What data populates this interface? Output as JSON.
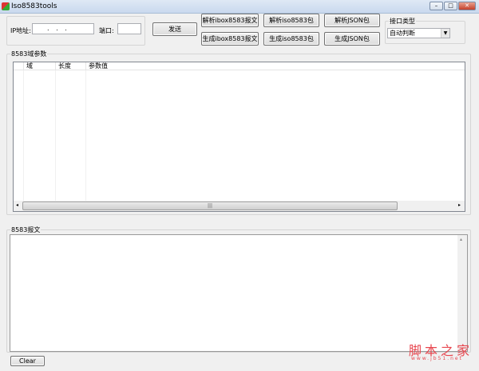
{
  "window": {
    "title": "Iso8583tools",
    "minimize": "–",
    "maximize": "□",
    "close": "✕"
  },
  "connection": {
    "ip_label": "IP地址:",
    "ip_value": ".   .   .",
    "port_label": "端口:",
    "port_value": "",
    "send": "发送"
  },
  "buttons": {
    "parse_ibox": "解析ibox8583报文",
    "gen_ibox": "生成ibox8583报文",
    "parse_iso": "解析iso8583包",
    "gen_iso": "生成iso8583包",
    "parse_json": "解析JSON包",
    "gen_json": "生成JSON包"
  },
  "interface_type": {
    "label": "接口类型",
    "selected": "自动判断"
  },
  "fields_group": {
    "label": "8583域参数",
    "columns": [
      "域",
      "长度",
      "参数值"
    ]
  },
  "message_group": {
    "label": "8583报文",
    "value": ""
  },
  "clear": "Clear",
  "watermark": {
    "text": "脚本之家",
    "url": "www.jb51.net"
  }
}
